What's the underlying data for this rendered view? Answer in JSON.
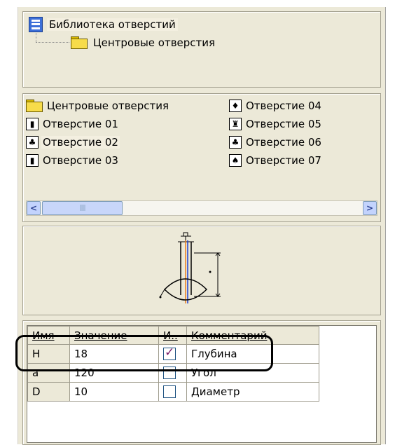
{
  "tree": {
    "root_label": "Библиотека отверстий",
    "child_label": "Центровые отверстия"
  },
  "list": {
    "items": [
      {
        "label": "Центровые отверстия",
        "icon": "folder-icon"
      },
      {
        "label": "Отверстие 01",
        "icon": "hole-icon"
      },
      {
        "label": "Отверстие 02",
        "icon": "hole-icon"
      },
      {
        "label": "Отверстие 03",
        "icon": "hole-icon"
      },
      {
        "label": "Отверстие 04",
        "icon": "hole-icon"
      },
      {
        "label": "Отверстие 05",
        "icon": "hole-icon"
      },
      {
        "label": "Отверстие 06",
        "icon": "hole-icon"
      },
      {
        "label": "Отверстие 07",
        "icon": "hole-icon"
      }
    ],
    "selected_index": 2
  },
  "grid": {
    "headers": [
      "Имя",
      "Значение",
      "И..",
      "Комментарий"
    ],
    "rows": [
      {
        "name": "H",
        "value": "18",
        "checked": true,
        "comment": "Глубина"
      },
      {
        "name": "a",
        "value": "120",
        "checked": false,
        "comment": "Угол"
      },
      {
        "name": "D",
        "value": "10",
        "checked": false,
        "comment": "Диаметр"
      }
    ]
  },
  "colors": {
    "panel_bg": "#ece9d8",
    "selection_bg": "#f3efe0",
    "check_mark": "#7a1f6b",
    "scroll_blue": "#c3d3fd"
  }
}
